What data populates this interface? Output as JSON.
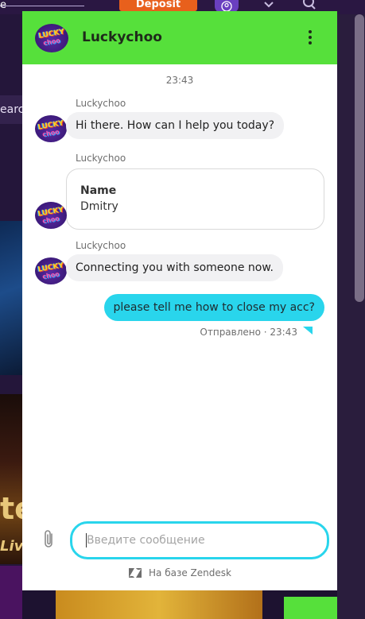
{
  "background_page": {
    "deposit_label": "Deposit",
    "partial_search_label": "earch",
    "partial_thumb_text": "te",
    "partial_thumb_subtext": "Liv",
    "corner_text": "e"
  },
  "chat": {
    "header": {
      "title": "Luckychoo",
      "logo_text_top": "LUCKY",
      "logo_text_bottom": "choo",
      "menu_icon": "kebab-menu-icon",
      "accent_color": "#56e03b"
    },
    "timestamp": "23:43",
    "messages": [
      {
        "sender": "Luckychoo",
        "text": "Hi there. How can I help you today?"
      },
      {
        "sender": "Luckychoo",
        "card": {
          "label": "Name",
          "value": "Dmitry"
        }
      },
      {
        "sender": "Luckychoo",
        "text": "Connecting you with someone now."
      }
    ],
    "outgoing": {
      "text": "please tell me how to close my acc?",
      "status": "Отправлено · 23:43",
      "bubble_color": "#29d5ec"
    },
    "input": {
      "placeholder": "Введите сообщение",
      "value": ""
    },
    "footer": {
      "text": "На базе Zendesk",
      "icon": "zendesk-icon"
    }
  }
}
